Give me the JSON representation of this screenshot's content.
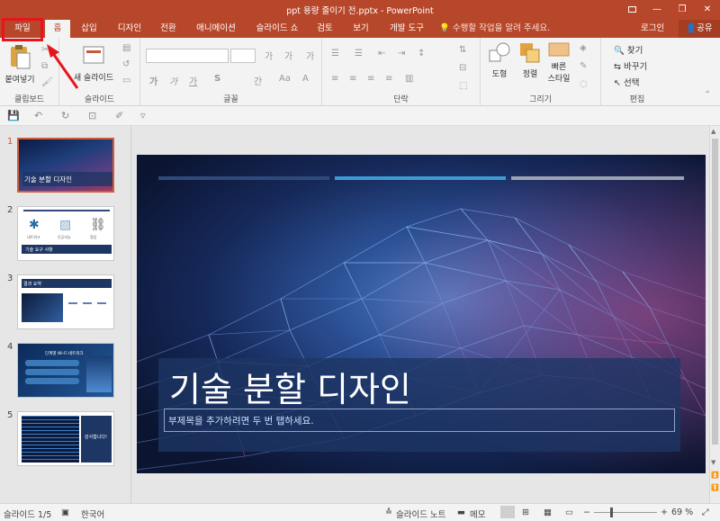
{
  "window": {
    "title": "ppt 용량 줄이기 전.pptx - PowerPoint"
  },
  "tabs": {
    "file": "파일",
    "home": "홈",
    "insert": "삽입",
    "design": "디자인",
    "transitions": "전환",
    "animations": "애니메이션",
    "slideshow": "슬라이드 쇼",
    "review": "검토",
    "view": "보기",
    "developer": "개발 도구"
  },
  "tell_me": "수행할 작업을 알려 주세요.",
  "account": {
    "login": "로그인",
    "share": "공유"
  },
  "ribbon": {
    "clipboard": {
      "paste": "붙여넣기",
      "label": "클립보드"
    },
    "slides": {
      "new_slide": "새 슬라이드",
      "label": "슬라이드"
    },
    "font": {
      "label": "글꼴",
      "decrease_size": "가",
      "increase_size": "가",
      "clear": "가",
      "bold": "가",
      "italic": "가",
      "underline": "가",
      "shadow": "S",
      "spacing": "간",
      "case": "Aa"
    },
    "paragraph": {
      "label": "단락"
    },
    "drawing": {
      "shapes": "도형",
      "arrange": "정렬",
      "quick_styles_1": "빠른",
      "quick_styles_2": "스타일",
      "label": "그리기"
    },
    "editing": {
      "find": "찾기",
      "replace": "바꾸기",
      "select": "선택",
      "label": "편집"
    }
  },
  "thumbnails": [
    {
      "num": "1",
      "title": "기술 분할 디자인"
    },
    {
      "num": "2",
      "caption": "기술 요구 사항",
      "icon_labels": [
        "네트워크",
        "인공지능",
        "협업"
      ]
    },
    {
      "num": "3",
      "heading": "결과 요약"
    },
    {
      "num": "4",
      "heading": "단계별 Wi-Fi 네트워크"
    },
    {
      "num": "5",
      "caption": "감사합니다!"
    }
  ],
  "slide": {
    "title": "기술 분할 디자인",
    "subtitle_placeholder": "부제목을 추가하려면 두 번 탭하세요."
  },
  "status": {
    "slide_counter": "슬라이드 1/5",
    "language": "한국어",
    "notes": "슬라이드 노트",
    "comments": "메모",
    "zoom": "69 %"
  },
  "colors": {
    "accent": "#b7472a",
    "highlight": "#e8141b",
    "slide_bar_1": "#2f4a7a",
    "slide_bar_2": "#3f9ad3",
    "slide_bar_3": "#9aa3b1"
  },
  "icons": [
    "save-icon",
    "undo-icon",
    "redo-icon",
    "start-slideshow-icon",
    "lightbulb-icon",
    "person-icon",
    "new-slide-icon",
    "paste-icon",
    "find-icon",
    "replace-icon",
    "select-icon",
    "notes-icon",
    "comments-icon",
    "normal-view-icon",
    "slide-sorter-icon",
    "reading-view-icon",
    "slideshow-view-icon"
  ]
}
